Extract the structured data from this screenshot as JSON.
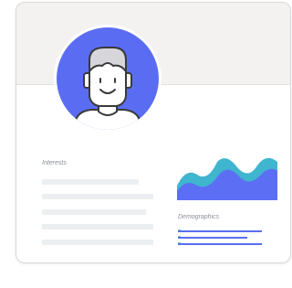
{
  "profile_card": {
    "interests": {
      "label": "Interests",
      "placeholder_line_count": 5
    },
    "demographics": {
      "label": "Demographics"
    }
  },
  "colors": {
    "avatar_background": "#5a6df2",
    "header_background": "#f4f2f1",
    "chart_back": "#3fb5cf",
    "chart_front": "#5b6ef4",
    "demographic_lines": "#5a6ef0",
    "demographic_dots": "#28c2a8",
    "placeholder_bars": "#eceff2"
  },
  "icons": {
    "avatar": "user-avatar-icon",
    "chart": "area-chart-icon"
  }
}
